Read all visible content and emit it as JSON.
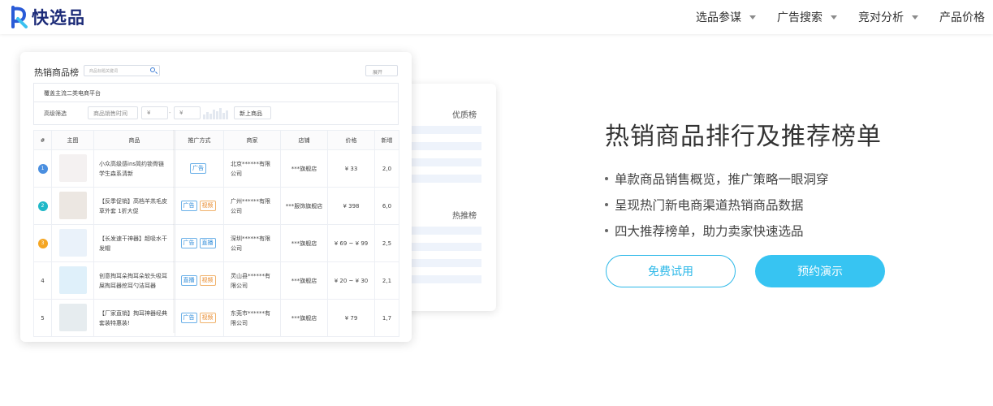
{
  "brand": {
    "name": "快选品",
    "logo_color": "#1c2b78",
    "accent": "#2a5bd7"
  },
  "nav": {
    "items": [
      {
        "label": "选品参谋",
        "has_dropdown": true
      },
      {
        "label": "广告搜索",
        "has_dropdown": true
      },
      {
        "label": "竞对分析",
        "has_dropdown": true
      },
      {
        "label": "产品价格",
        "has_dropdown": false
      }
    ]
  },
  "back_card": {
    "titles": [
      "优质榜",
      "热推榜"
    ]
  },
  "ranking": {
    "title": "热销商品榜",
    "search_placeholder": "商品标题关键词",
    "expand_label": "展开",
    "platform_text": "覆盖主流二类电商平台",
    "filter": {
      "label": "高级筛选",
      "time_placeholder": "商品销售时间",
      "min_placeholder": "¥",
      "range_sep": "-",
      "max_placeholder": "¥",
      "new_button": "新上商品"
    },
    "columns": [
      "#",
      "主图",
      "商品",
      "推广方式",
      "商家",
      "店铺",
      "价格",
      "新增"
    ],
    "rows": [
      {
        "rank": "1",
        "rank_color": "#4a8fe0",
        "product": "小众高级感ins简约锁骨链学生森系清新",
        "tags": [
          {
            "text": "广告",
            "color": "blue"
          }
        ],
        "merchant": "北京******有限公司",
        "shop": "***旗舰店",
        "price": "¥ 33",
        "new": "2,0",
        "thumb": "#f4f1f1"
      },
      {
        "rank": "2",
        "rank_color": "#20b8c8",
        "product": "【反季促销】高档羊羔毛皮草外套 1折大促",
        "tags": [
          {
            "text": "广告",
            "color": "blue"
          },
          {
            "text": "视频",
            "color": "orange"
          }
        ],
        "merchant": "广州******有限公司",
        "shop": "***服饰旗舰店",
        "price": "¥ 398",
        "new": "6,0",
        "thumb": "#ece7e2"
      },
      {
        "rank": "3",
        "rank_color": "#f5a623",
        "product": "【长发速干神器】超吸水干发帽",
        "tags": [
          {
            "text": "广告",
            "color": "blue"
          },
          {
            "text": "直播",
            "color": "blue"
          }
        ],
        "merchant": "深圳******有限公司",
        "shop": "***旗舰店",
        "price": "¥ 69 ~ ¥ 99",
        "new": "2,5",
        "thumb": "#eaf2fa"
      },
      {
        "rank": "4",
        "rank_color": "",
        "product": "创意掏耳朵掏耳朵软头吸耳屎掏耳器挖耳勺洁耳器",
        "tags": [
          {
            "text": "直播",
            "color": "blue"
          },
          {
            "text": "视频",
            "color": "orange"
          }
        ],
        "merchant": "灵山县******有限公司",
        "shop": "***旗舰店",
        "price": "¥ 20 ~ ¥ 30",
        "new": "2,1",
        "thumb": "#dff0fa"
      },
      {
        "rank": "5",
        "rank_color": "",
        "product": "【厂家直销】掏耳神器经典套装特惠装!",
        "tags": [
          {
            "text": "广告",
            "color": "blue"
          },
          {
            "text": "视频",
            "color": "orange"
          }
        ],
        "merchant": "东莞市******有限公司",
        "shop": "***旗舰店",
        "price": "¥ 79",
        "new": "1,7",
        "thumb": "#e6ecef"
      }
    ]
  },
  "hero": {
    "title": "热销商品排行及推荐榜单",
    "bullets": [
      "单款商品销售概览，推广策略一眼洞穿",
      "呈现热门新电商渠道热销商品数据",
      "四大推荐榜单，助力卖家快速选品"
    ],
    "btn_trial": "免费试用",
    "btn_demo": "预约演示",
    "accent": "#37c4f2"
  }
}
